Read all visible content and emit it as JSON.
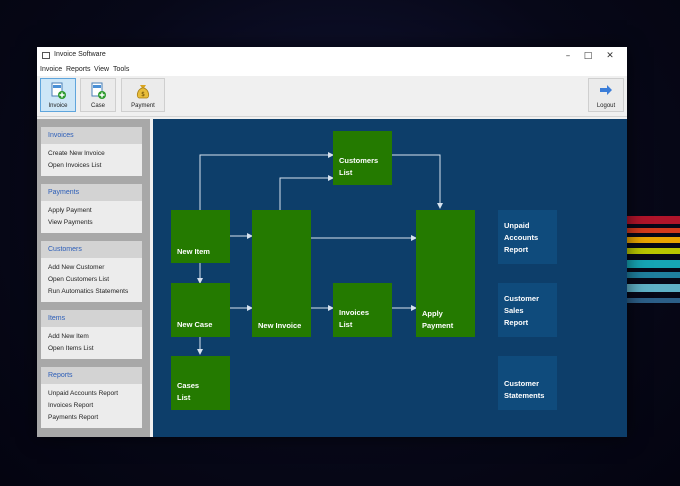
{
  "window": {
    "title": "Invoice Software"
  },
  "menu": [
    "Invoice",
    "Reports",
    "View",
    "Tools"
  ],
  "toolbar": {
    "invoice_label": "Invoice",
    "case_label": "Case",
    "payment_label": "Payment",
    "logout_label": "Logout"
  },
  "sidebar": {
    "groups": [
      {
        "title": "Invoices",
        "items": [
          "Create New Invoice",
          "Open Invoices List"
        ]
      },
      {
        "title": "Payments",
        "items": [
          "Apply Payment",
          "View Payments"
        ]
      },
      {
        "title": "Customers",
        "items": [
          "Add New Customer",
          "Open Customers List",
          "Run Automatics Statements"
        ]
      },
      {
        "title": "Items",
        "items": [
          "Add New Item",
          "Open Items List"
        ]
      },
      {
        "title": "Reports",
        "items": [
          "Unpaid Accounts Report",
          "Invoices Report",
          "Payments Report"
        ]
      }
    ]
  },
  "flow": {
    "new_item": [
      "New Item"
    ],
    "new_case": [
      "New Case"
    ],
    "cases_list": [
      "Cases",
      "List"
    ],
    "new_invoice": [
      "New Invoice"
    ],
    "customers_list": [
      "Customers",
      "List"
    ],
    "invoices_list": [
      "Invoices",
      "List"
    ],
    "apply_payment": [
      "Apply",
      "Payment"
    ],
    "unpaid_report": [
      "Unpaid",
      "Accounts",
      "Report"
    ],
    "sales_report": [
      "Customer",
      "Sales",
      "Report"
    ],
    "statements": [
      "Customer",
      "Statements"
    ]
  },
  "colors": {
    "flow_green": "#247a00",
    "flow_blue": "#0f4b7c",
    "canvas": "#0d3e6a",
    "active_button": "#cde6f7",
    "group_heading": "#2b5db8"
  },
  "icons": {
    "invoice": "document-add-icon",
    "case": "case-add-icon",
    "payment": "money-bag-icon",
    "logout": "arrow-right-icon"
  }
}
